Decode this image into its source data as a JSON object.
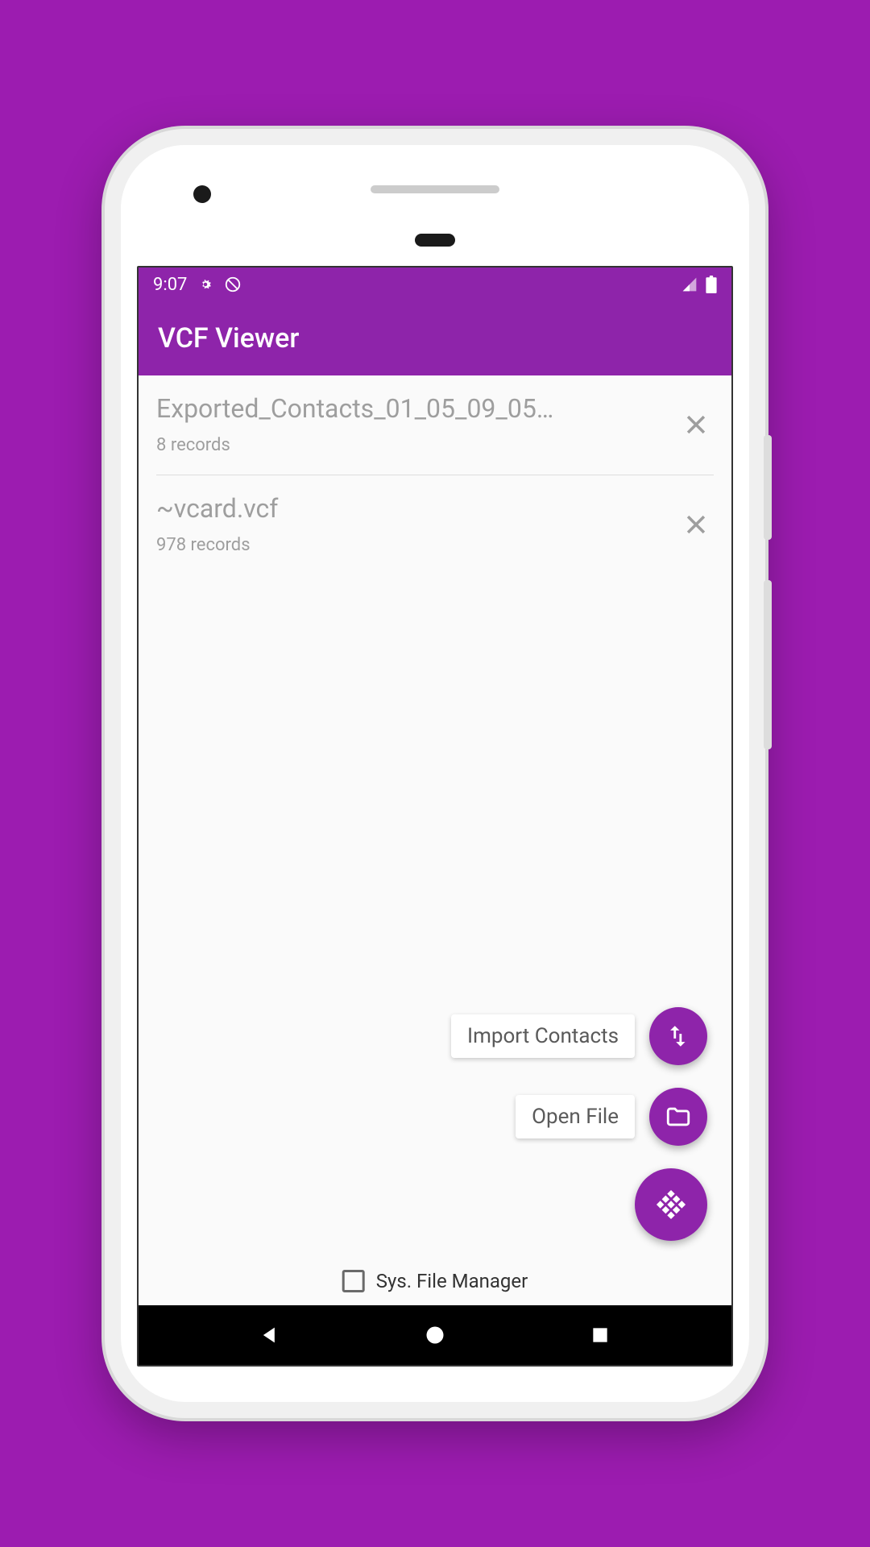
{
  "status": {
    "time": "9:07"
  },
  "appbar": {
    "title": "VCF Viewer"
  },
  "files": [
    {
      "name": "Exported_Contacts_01_05_09_05…",
      "records": "8 records"
    },
    {
      "name": "~vcard.vcf",
      "records": "978 records"
    }
  ],
  "fab": {
    "import_label": "Import Contacts",
    "open_label": "Open File"
  },
  "checkbox": {
    "label": "Sys. File Manager"
  }
}
